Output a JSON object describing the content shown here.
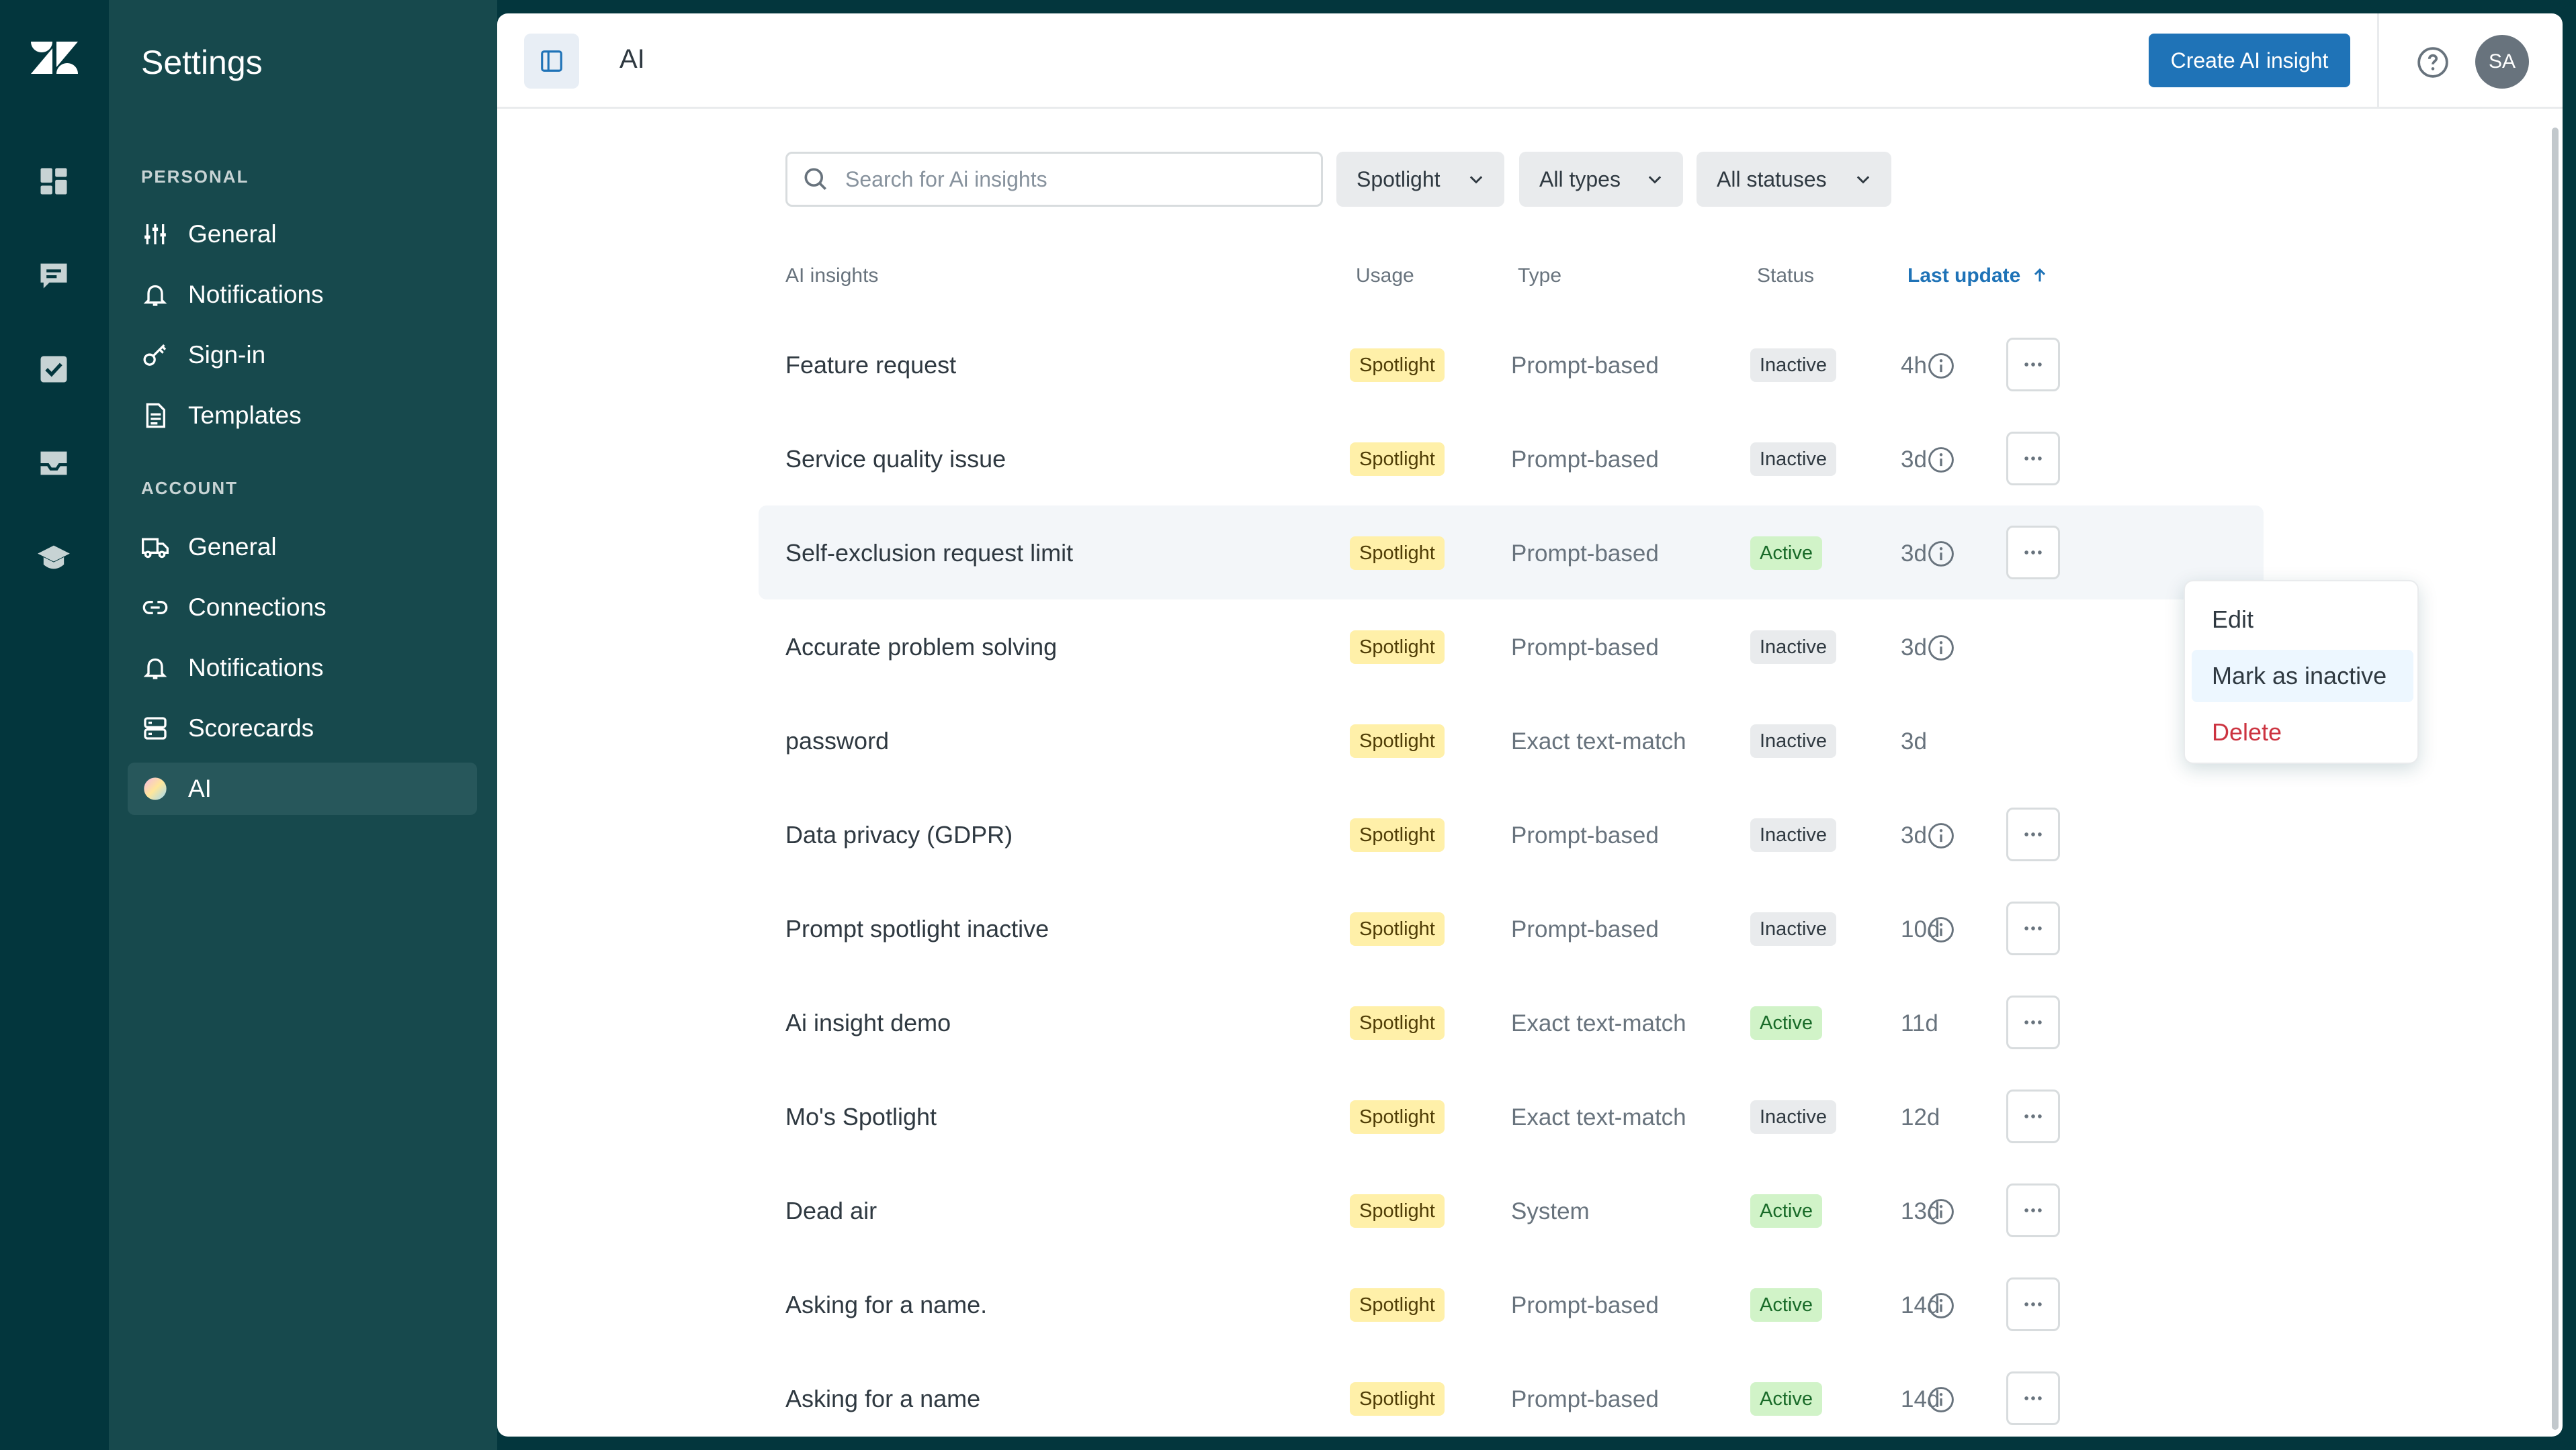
{
  "rail": {
    "items": [
      "dashboard",
      "conversations",
      "reviews",
      "inbox",
      "training"
    ]
  },
  "sidebar": {
    "title": "Settings",
    "personal_label": "PERSONAL",
    "personal_items": [
      {
        "label": "General",
        "icon": "sliders-icon"
      },
      {
        "label": "Notifications",
        "icon": "bell-icon"
      },
      {
        "label": "Sign-in",
        "icon": "key-icon"
      },
      {
        "label": "Templates",
        "icon": "document-icon"
      }
    ],
    "account_label": "ACCOUNT",
    "account_items": [
      {
        "label": "General",
        "icon": "truck-icon"
      },
      {
        "label": "Connections",
        "icon": "link-icon"
      },
      {
        "label": "Notifications",
        "icon": "bell-icon"
      },
      {
        "label": "Scorecards",
        "icon": "server-icon"
      },
      {
        "label": "AI",
        "icon": "ai-orb-icon",
        "active": true
      }
    ]
  },
  "header": {
    "title": "AI",
    "create_button": "Create AI insight",
    "avatar_initials": "SA"
  },
  "filters": {
    "search_placeholder": "Search for Ai insights",
    "usage": "Spotlight",
    "type": "All types",
    "status": "All statuses"
  },
  "table": {
    "columns": [
      "AI insights",
      "Usage",
      "Type",
      "Status",
      "Last update"
    ],
    "sorted_column": "Last update",
    "rows": [
      {
        "name": "Feature request",
        "usage": "Spotlight",
        "type": "Prompt-based",
        "status": "Inactive",
        "updated": "4h",
        "info": true
      },
      {
        "name": "Service quality issue",
        "usage": "Spotlight",
        "type": "Prompt-based",
        "status": "Inactive",
        "updated": "3d",
        "info": true
      },
      {
        "name": "Self-exclusion request limit",
        "usage": "Spotlight",
        "type": "Prompt-based",
        "status": "Active",
        "updated": "3d",
        "info": true
      },
      {
        "name": "Accurate problem solving",
        "usage": "Spotlight",
        "type": "Prompt-based",
        "status": "Inactive",
        "updated": "3d",
        "info": true
      },
      {
        "name": "password",
        "usage": "Spotlight",
        "type": "Exact text-match",
        "status": "Inactive",
        "updated": "3d",
        "info": false
      },
      {
        "name": "Data privacy (GDPR)",
        "usage": "Spotlight",
        "type": "Prompt-based",
        "status": "Inactive",
        "updated": "3d",
        "info": true
      },
      {
        "name": "Prompt spotlight inactive",
        "usage": "Spotlight",
        "type": "Prompt-based",
        "status": "Inactive",
        "updated": "10d",
        "info": true
      },
      {
        "name": "Ai insight demo",
        "usage": "Spotlight",
        "type": "Exact text-match",
        "status": "Active",
        "updated": "11d",
        "info": false
      },
      {
        "name": "Mo's Spotlight",
        "usage": "Spotlight",
        "type": "Exact text-match",
        "status": "Inactive",
        "updated": "12d",
        "info": false
      },
      {
        "name": "Dead air",
        "usage": "Spotlight",
        "type": "System",
        "status": "Active",
        "updated": "13d",
        "info": true
      },
      {
        "name": "Asking for a name.",
        "usage": "Spotlight",
        "type": "Prompt-based",
        "status": "Active",
        "updated": "14d",
        "info": true
      },
      {
        "name": "Asking for a name",
        "usage": "Spotlight",
        "type": "Prompt-based",
        "status": "Active",
        "updated": "14d",
        "info": true
      }
    ]
  },
  "menu": {
    "items": [
      "Edit",
      "Mark as inactive",
      "Delete"
    ]
  },
  "colors": {
    "rail": "#03363d",
    "sidebar": "#17494d",
    "primary": "#1f73b7",
    "danger": "#cc3340"
  }
}
